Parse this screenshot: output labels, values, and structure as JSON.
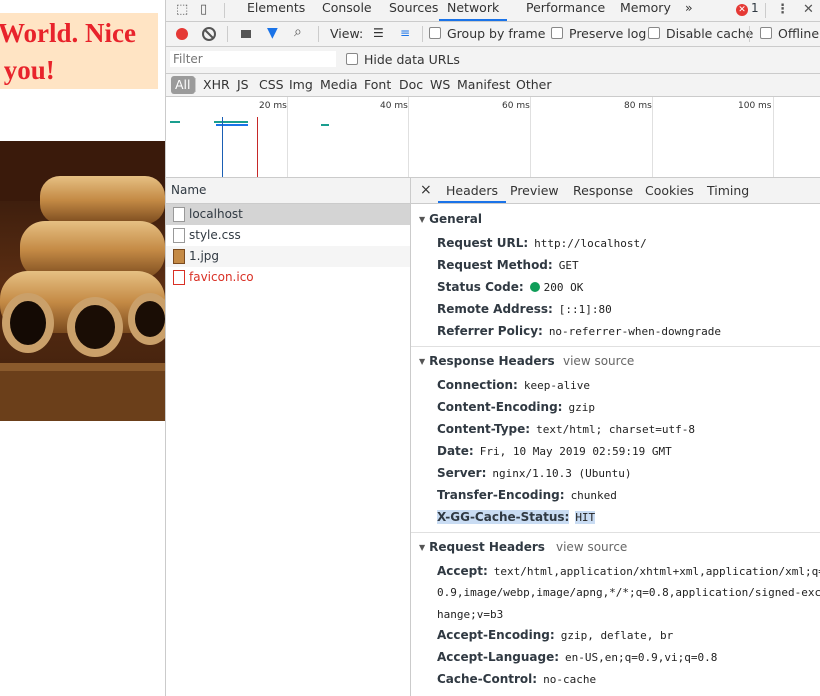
{
  "page": {
    "hello_line1": "World. Nice",
    "hello_line2": "t you!"
  },
  "devtools": {
    "tabs": [
      "Elements",
      "Console",
      "Sources",
      "Network",
      "Performance",
      "Memory"
    ],
    "more_tabs": "»",
    "error_count": "1",
    "toolbar": {
      "view_label": "View:",
      "group_by_frame": "Group by frame",
      "preserve_log": "Preserve log",
      "disable_cache": "Disable cache",
      "offline": "Offline"
    },
    "filter": {
      "placeholder": "Filter",
      "hide_data_urls": "Hide data URLs",
      "types": [
        "All",
        "XHR",
        "JS",
        "CSS",
        "Img",
        "Media",
        "Font",
        "Doc",
        "WS",
        "Manifest",
        "Other"
      ]
    },
    "timeline": {
      "ticks": [
        "20 ms",
        "40 ms",
        "60 ms",
        "80 ms",
        "100 ms"
      ]
    },
    "requests": {
      "header": "Name",
      "items": [
        {
          "name": "localhost",
          "color": "#303942"
        },
        {
          "name": "style.css",
          "color": "#303942"
        },
        {
          "name": "1.jpg",
          "color": "#303942"
        },
        {
          "name": "favicon.ico",
          "color": "#d93025"
        }
      ]
    },
    "details": {
      "close": "×",
      "tabs": [
        "Headers",
        "Preview",
        "Response",
        "Cookies",
        "Timing"
      ],
      "general": {
        "title": "General",
        "rows": [
          {
            "k": "Request URL:",
            "v": "http://localhost/"
          },
          {
            "k": "Request Method:",
            "v": "GET"
          },
          {
            "k": "Status Code:",
            "v": "200 OK"
          },
          {
            "k": "Remote Address:",
            "v": "[::1]:80"
          },
          {
            "k": "Referrer Policy:",
            "v": "no-referrer-when-downgrade"
          }
        ]
      },
      "response_headers": {
        "title": "Response Headers",
        "view_source": "view source",
        "rows": [
          {
            "k": "Connection:",
            "v": "keep-alive"
          },
          {
            "k": "Content-Encoding:",
            "v": "gzip"
          },
          {
            "k": "Content-Type:",
            "v": "text/html; charset=utf-8"
          },
          {
            "k": "Date:",
            "v": "Fri, 10 May 2019 02:59:19 GMT"
          },
          {
            "k": "Server:",
            "v": "nginx/1.10.3 (Ubuntu)"
          },
          {
            "k": "Transfer-Encoding:",
            "v": "chunked"
          },
          {
            "k": "X-GG-Cache-Status:",
            "v": "HIT"
          }
        ]
      },
      "request_headers": {
        "title": "Request Headers",
        "view_source": "view source",
        "accept_key": "Accept:",
        "accept_l1": "text/html,application/xhtml+xml,application/xml;q=",
        "accept_l2": "0.9,image/webp,image/apng,*/*;q=0.8,application/signed-exc",
        "accept_l3": "hange;v=b3",
        "rows": [
          {
            "k": "Accept-Encoding:",
            "v": "gzip, deflate, br"
          },
          {
            "k": "Accept-Language:",
            "v": "en-US,en;q=0.9,vi;q=0.8"
          },
          {
            "k": "Cache-Control:",
            "v": "no-cache"
          }
        ]
      }
    }
  }
}
